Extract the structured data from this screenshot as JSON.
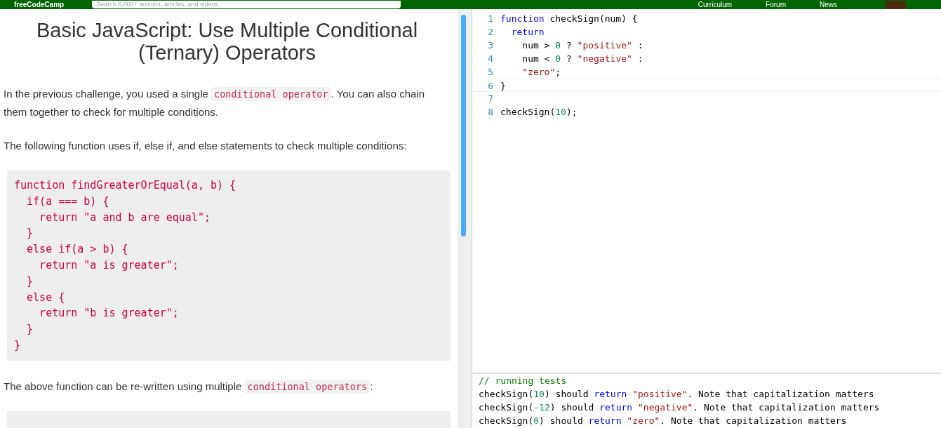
{
  "navbar": {
    "logo": "freeCodeCamp",
    "search": {
      "placeholder": "Search 6,000+ lessons, articles, and videos"
    },
    "links": [
      "Curriculum",
      "Forum",
      "News"
    ]
  },
  "lesson": {
    "title": "Basic JavaScript: Use Multiple Conditional (Ternary) Operators",
    "paragraphs": [
      [
        {
          "kind": "text",
          "text": "In the previous challenge, you used a single "
        },
        {
          "kind": "code",
          "text": "conditional operator"
        },
        {
          "kind": "text",
          "text": ". You can also chain them together to check for multiple conditions."
        }
      ],
      [
        {
          "kind": "text",
          "text": "The following function uses if, else if, and else statements to check multiple conditions:"
        }
      ],
      {
        "code": [
          "function findGreaterOrEqual(a, b) {",
          "  if(a === b) {",
          "    return \"a and b are equal\";",
          "  }",
          "  else if(a > b) {",
          "    return \"a is greater\";",
          "  }",
          "  else {",
          "    return \"b is greater\";",
          "  }",
          "}"
        ]
      },
      [
        {
          "kind": "text",
          "text": "The above function can be re-written using multiple "
        },
        {
          "kind": "code",
          "text": "conditional operators"
        },
        {
          "kind": "text",
          "text": ":"
        }
      ],
      {
        "kind": "code_block"
      }
    ]
  },
  "editor": {
    "lines": [
      {
        "number": "1",
        "selected": false,
        "tokens": [
          {
            "kind": "keyword",
            "text": "function"
          },
          {
            "kind": "plain",
            "text": " checkSign(num) {"
          }
        ]
      },
      {
        "number": "2",
        "selected": false,
        "tokens": [
          {
            "kind": "keyword",
            "text": "  return"
          }
        ]
      },
      {
        "number": "3",
        "selected": false,
        "tokens": [
          {
            "kind": "plain",
            "text": "    num > "
          },
          {
            "kind": "number",
            "text": "0"
          },
          {
            "kind": "plain",
            "text": " ? "
          },
          {
            "kind": "string",
            "text": "\"positive\""
          },
          {
            "kind": "plain",
            "text": " :"
          }
        ]
      },
      {
        "number": "4",
        "selected": false,
        "tokens": [
          {
            "kind": "plain",
            "text": "    num < "
          },
          {
            "kind": "number",
            "text": "0"
          },
          {
            "kind": "plain",
            "text": " ? "
          },
          {
            "kind": "string",
            "text": "\"negative\""
          },
          {
            "kind": "plain",
            "text": " :"
          }
        ]
      },
      {
        "number": "5",
        "selected": false,
        "tokens": [
          {
            "kind": "string",
            "text": "    \"zero\""
          },
          {
            "kind": "plain",
            "text": ";"
          }
        ]
      },
      {
        "number": "6",
        "selected": true,
        "tokens": [
          {
            "kind": "plain",
            "text": "}"
          }
        ]
      },
      {
        "number": "7",
        "selected": false
      },
      {
        "number": "8",
        "selected": false,
        "tokens": [
          {
            "kind": "plain",
            "text": "checkSign("
          },
          {
            "kind": "number",
            "text": "10"
          },
          {
            "kind": "plain",
            "text": ");"
          }
        ]
      }
    ]
  },
  "tests": {
    "lines": [
      [
        {
          "kind": "comment",
          "text": "// running tests"
        }
      ],
      [
        {
          "kind": "plain",
          "text": "checkSign("
        },
        {
          "kind": "number",
          "text": "10"
        },
        {
          "kind": "plain",
          "text": ") should "
        },
        {
          "kind": "keyword",
          "text": "return"
        },
        {
          "kind": "string",
          "text": " \"positive\""
        },
        {
          "kind": "plain",
          "text": ". Note that capitalization matters"
        }
      ],
      [
        {
          "kind": "plain",
          "text": "checkSign("
        },
        {
          "kind": "number",
          "text": "-12"
        },
        {
          "kind": "plain",
          "text": ") should "
        },
        {
          "kind": "keyword",
          "text": "return"
        },
        {
          "kind": "string",
          "text": " \"negative\""
        },
        {
          "kind": "plain",
          "text": ". Note that capitalization matters"
        }
      ],
      [
        {
          "kind": "plain",
          "text": "checkSign("
        },
        {
          "kind": "number",
          "text": "0"
        },
        {
          "kind": "plain",
          "text": ") should "
        },
        {
          "kind": "keyword",
          "text": "return"
        },
        {
          "kind": "string",
          "text": " \"zero\""
        },
        {
          "kind": "plain",
          "text": ". Note that capitalization matters"
        }
      ]
    ]
  }
}
